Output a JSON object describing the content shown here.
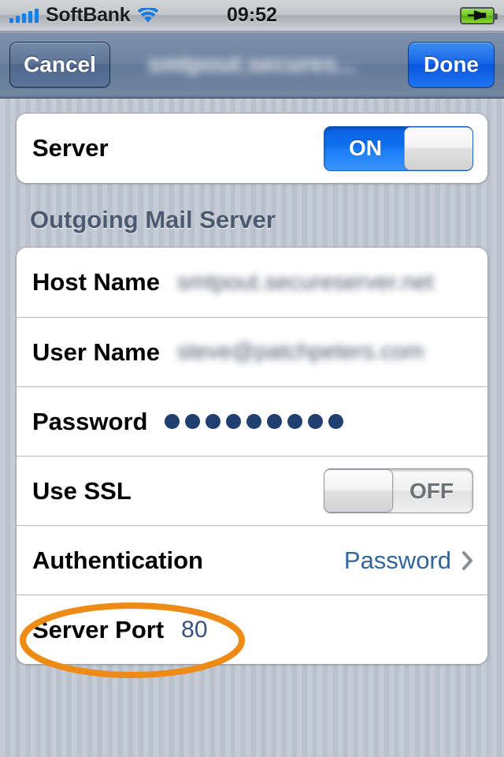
{
  "status_bar": {
    "carrier": "SoftBank",
    "time": "09:52",
    "signal_icon": "signal-bars-icon",
    "wifi_icon": "wifi-icon",
    "battery_icon": "battery-charging-icon",
    "signal_bars": 5
  },
  "nav_bar": {
    "cancel_label": "Cancel",
    "done_label": "Done",
    "title": "smtpout.secures...",
    "title_redacted": true
  },
  "server_section": {
    "row_label": "Server",
    "toggle_state": "ON",
    "toggle_on": true
  },
  "outgoing_section": {
    "header": "Outgoing Mail Server",
    "rows": [
      {
        "label": "Host Name",
        "value": "smtpout.secureserver.net",
        "redacted": true,
        "type": "text"
      },
      {
        "label": "User Name",
        "value": "steve@patchpeters.com",
        "redacted": true,
        "type": "text"
      },
      {
        "label": "Password",
        "value": "",
        "dots": 9,
        "type": "password"
      },
      {
        "label": "Use SSL",
        "value": "OFF",
        "toggle_on": false,
        "type": "toggle"
      },
      {
        "label": "Authentication",
        "value": "Password",
        "type": "disclosure"
      },
      {
        "label": "Server Port",
        "value": "80",
        "type": "text"
      }
    ]
  },
  "annotation": {
    "target": "Server Port",
    "shape": "ellipse",
    "color": "#ED8B16"
  },
  "colors": {
    "accent_blue": "#1567e8",
    "value_blue": "#31659d",
    "annotation_orange": "#ED8B16",
    "header_gray": "#4b5a71",
    "background": "#c2c9d3"
  }
}
